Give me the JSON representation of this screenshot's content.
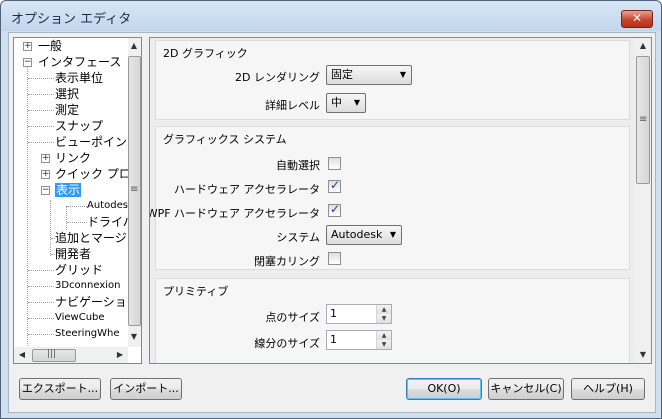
{
  "window": {
    "title": "オプション エディタ",
    "close_label": "✕"
  },
  "tree": {
    "items": [
      {
        "label": "一般",
        "expander": "+"
      },
      {
        "label": "インタフェース",
        "expander": "−"
      },
      {
        "label": "表示単位"
      },
      {
        "label": "選択"
      },
      {
        "label": "測定"
      },
      {
        "label": "スナップ"
      },
      {
        "label": "ビューポイント"
      },
      {
        "label": "リンク",
        "expander": "+"
      },
      {
        "label": "クイック プロパ",
        "expander": "+"
      },
      {
        "label": "表示",
        "expander": "−"
      },
      {
        "label": "Autodes"
      },
      {
        "label": "ドライバ"
      },
      {
        "label": "追加とマージ"
      },
      {
        "label": "開発者"
      },
      {
        "label": "グリッド"
      },
      {
        "label": "3Dconnexion"
      },
      {
        "label": "ナビゲーション"
      },
      {
        "label": "ViewCube"
      },
      {
        "label": "SteeringWhe"
      }
    ]
  },
  "sections": {
    "graphics2d": {
      "title": "2D グラフィック",
      "rendering_label": "2D レンダリング",
      "rendering_value": "固定",
      "detail_label": "詳細レベル",
      "detail_value": "中"
    },
    "graphics_system": {
      "title": "グラフィックス システム",
      "auto_select_label": "自動選択",
      "auto_select_checked": false,
      "hw_accel_label": "ハードウェア アクセラレータ",
      "hw_accel_checked": true,
      "wpf_hw_accel_label": "WPF ハードウェア アクセラレータ",
      "wpf_hw_accel_checked": true,
      "system_label": "システム",
      "system_value": "Autodesk",
      "occlusion_label": "閉塞カリング",
      "occlusion_checked": false
    },
    "primitives": {
      "title": "プリミティブ",
      "point_size_label": "点のサイズ",
      "point_size_value": "1",
      "line_size_label": "線分のサイズ",
      "line_size_value": "1"
    }
  },
  "footer": {
    "export_label": "エクスポート...",
    "import_label": "インポート...",
    "ok_label": "OK(O)",
    "cancel_label": "キャンセル(C)",
    "help_label": "ヘルプ(H)"
  },
  "icons": {
    "check": "✓",
    "dropdown": "chevron-down-icon",
    "grip": "grip-icon"
  }
}
